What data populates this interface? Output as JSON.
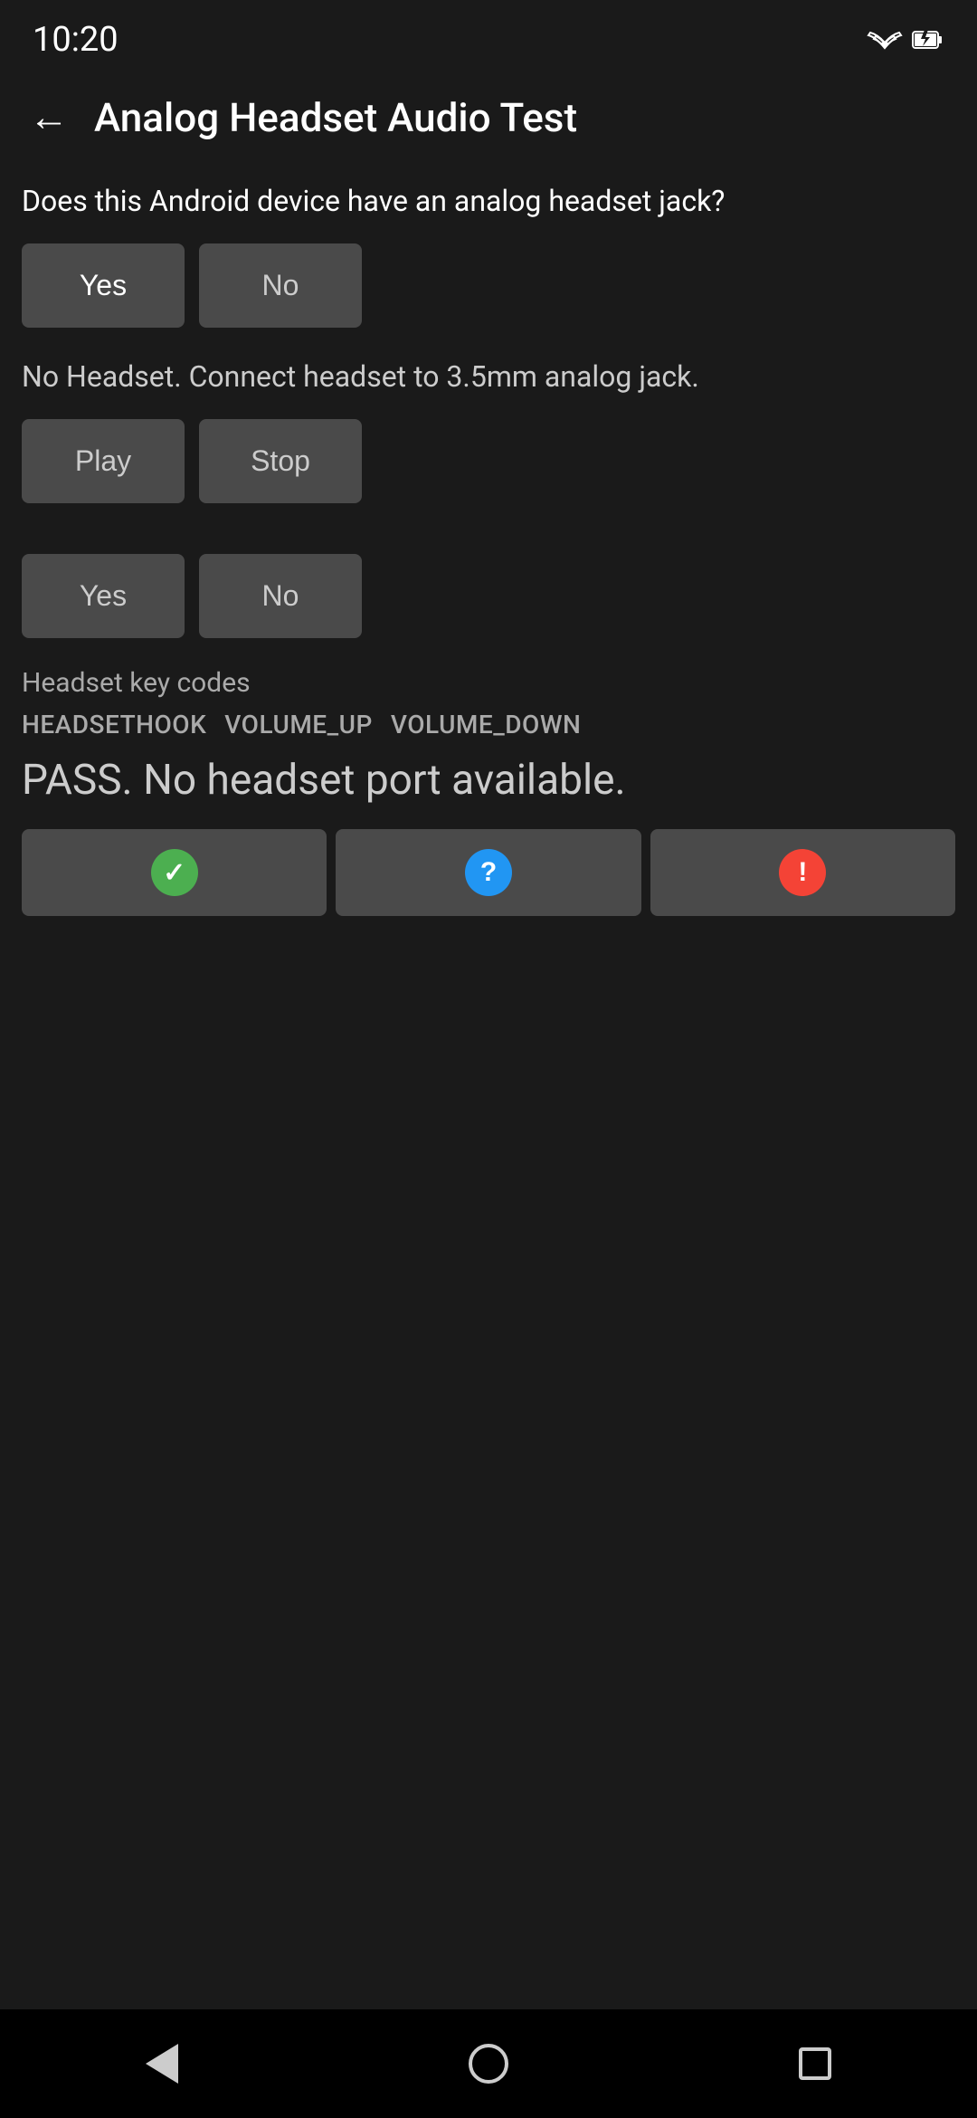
{
  "statusBar": {
    "time": "10:20",
    "wifiLabel": "wifi",
    "batteryLabel": "battery"
  },
  "toolbar": {
    "backLabel": "←",
    "title": "Analog Headset Audio Test"
  },
  "section1": {
    "question": "Does this Android device have an analog headset jack?",
    "yesLabel": "Yes",
    "noLabel": "No"
  },
  "section2": {
    "instruction": "No Headset. Connect headset to 3.5mm analog jack.",
    "playLabel": "Play",
    "stopLabel": "Stop",
    "yesLabel": "Yes",
    "noLabel": "No"
  },
  "keyCodes": {
    "label": "Headset key codes",
    "codes": [
      "HEADSETHOOK",
      "VOLUME_UP",
      "VOLUME_DOWN"
    ]
  },
  "passText": "PASS. No headset port available.",
  "resultButtons": {
    "passIconLabel": "✓",
    "infoIconLabel": "?",
    "failIconLabel": "!"
  },
  "navBar": {
    "backLabel": "back",
    "homeLabel": "home",
    "recentLabel": "recent"
  }
}
